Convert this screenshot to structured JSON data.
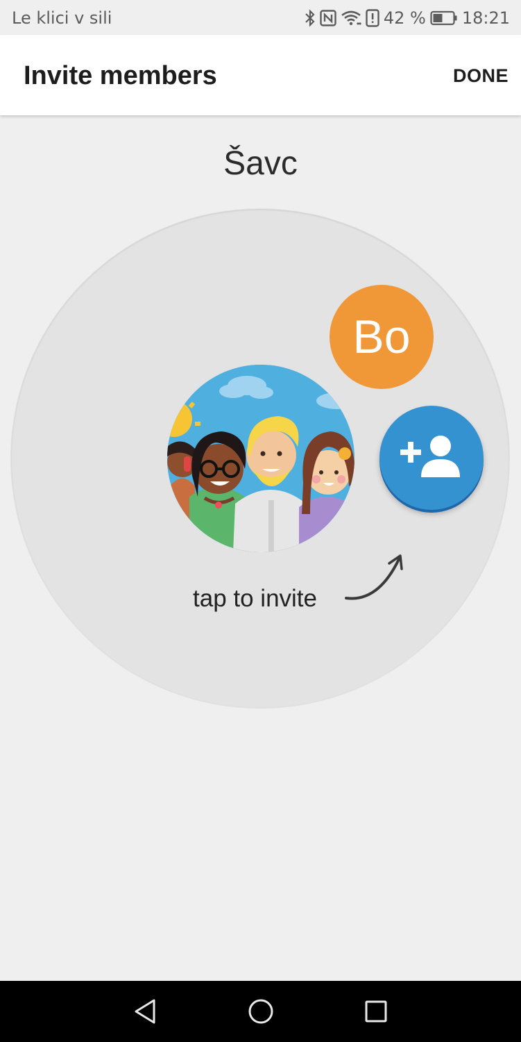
{
  "status_bar": {
    "carrier": "Le klici v sili",
    "battery": "42 %",
    "time": "18:21",
    "icons": [
      "bluetooth-icon",
      "nfc-icon",
      "wifi-icon",
      "alert-icon",
      "battery-icon"
    ]
  },
  "app_bar": {
    "title": "Invite members",
    "done_label": "DONE"
  },
  "group": {
    "name": "Šavc"
  },
  "members": [
    {
      "initials": "Bo",
      "color": "#f09737"
    }
  ],
  "invite": {
    "icon": "person-add-icon",
    "hint": "tap to invite",
    "button_color": "#3492d1"
  },
  "nav_bar": {
    "icons": [
      "back-icon",
      "home-icon",
      "recents-icon"
    ]
  }
}
